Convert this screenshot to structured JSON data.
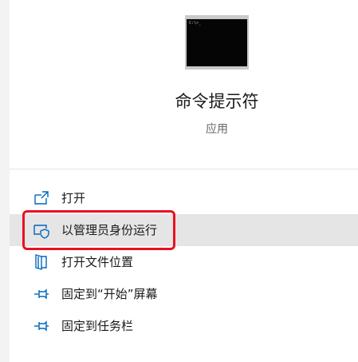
{
  "app": {
    "icon": "command-prompt-icon",
    "icon_caption": "C:\\>_",
    "title": "命令提示符",
    "subtitle": "应用"
  },
  "menu": {
    "items": [
      {
        "label": "打开",
        "icon": "open-icon"
      },
      {
        "label": "以管理员身份运行",
        "icon": "admin-shield-icon",
        "highlighted": true
      },
      {
        "label": "打开文件位置",
        "icon": "file-location-icon"
      },
      {
        "label": "固定到“开始”屏幕",
        "icon": "pin-icon"
      },
      {
        "label": "固定到任务栏",
        "icon": "pin-icon"
      }
    ]
  },
  "colors": {
    "accent": "#0067c0",
    "highlight_border": "#e81123",
    "hover_background": "#e5e5e5"
  }
}
